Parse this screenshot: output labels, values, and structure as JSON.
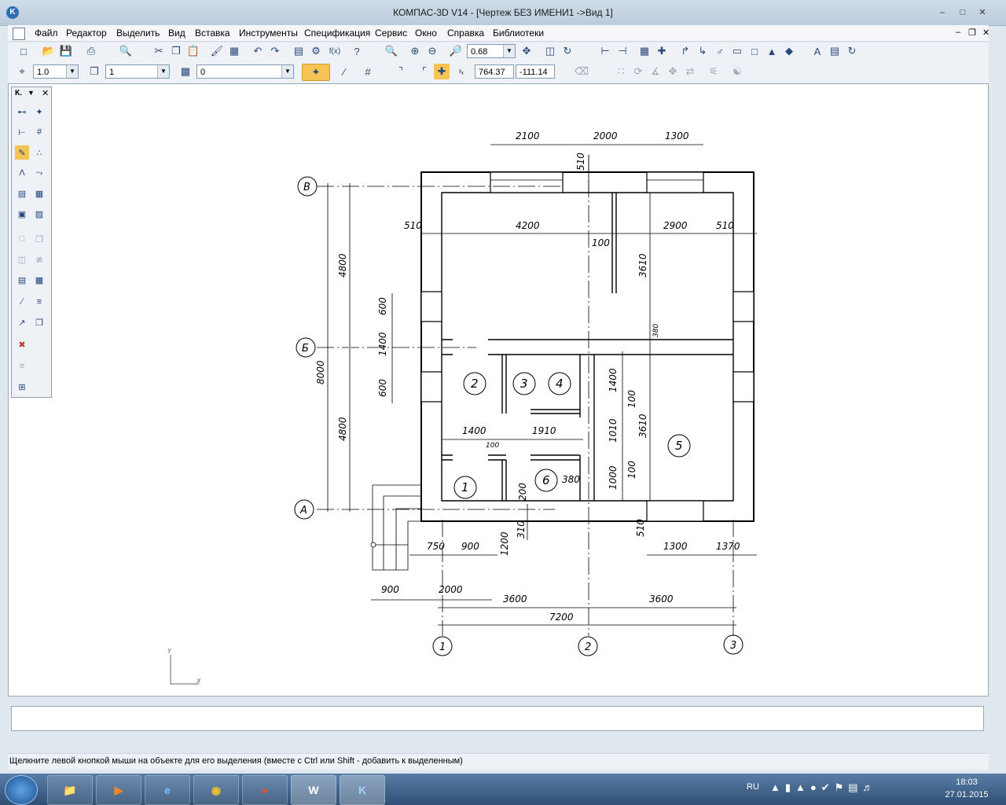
{
  "window": {
    "title": "КОМПАС-3D V14 - [Чертеж БЕЗ ИМЕНИ1 ->Вид 1]",
    "logo": "K"
  },
  "menu": [
    "Файл",
    "Редактор",
    "Выделить",
    "Вид",
    "Вставка",
    "Инструменты",
    "Спецификация",
    "Сервис",
    "Окно",
    "Справка",
    "Библиотеки"
  ],
  "toolbar": {
    "zoom_value": "0.68",
    "line_scale": "1.0",
    "layer": "1",
    "style": "0",
    "coord_x": "764.37",
    "coord_y": "-111.14",
    "fx_label": "f(x)"
  },
  "palette": {
    "title": "К."
  },
  "drawing": {
    "dimensions": {
      "top_2100": "2100",
      "top_2000": "2000",
      "top_1300": "1300",
      "top_510": "510",
      "row_510_left": "510",
      "row_4200": "4200",
      "row_2900": "2900",
      "row_510_right": "510",
      "d_100_top": "100",
      "d_3610_top": "3610",
      "d_380": "380",
      "d_4800_top": "4800",
      "d_8000": "8000",
      "d_4800_bottom": "4800",
      "d_600_a": "600",
      "d_1400_left": "1400",
      "d_600_b": "600",
      "d_1400_h": "1400",
      "d_1910": "1910",
      "d_100_mid": "100",
      "d_1400_v": "1400",
      "d_100_v1": "100",
      "d_1010": "1010",
      "d_3610_bottom": "3610",
      "d_100_v2": "100",
      "d_1000": "1000",
      "d_380_b": "380",
      "d_200": "200",
      "d_1200": "1200",
      "d_310": "310",
      "d_510_bottom": "510",
      "d_750": "750",
      "d_900": "900",
      "d_1300_b": "1300",
      "d_1370": "1370",
      "d_900_b": "900",
      "d_2000_b": "2000",
      "d_3600_left": "3600",
      "d_3600_right": "3600",
      "d_7200": "7200"
    },
    "axes_letters": [
      "В",
      "Б",
      "А"
    ],
    "axes_numbers": [
      "1",
      "2",
      "3"
    ],
    "rooms": [
      "1",
      "2",
      "3",
      "4",
      "5",
      "6"
    ],
    "ucs_x": "X",
    "ucs_y": "Y"
  },
  "status": {
    "hint": "Щелкните левой кнопкой мыши на объекте для его выделения (вместе с Ctrl или Shift - добавить к выделенным)"
  },
  "taskbar": {
    "lang": "RU",
    "time": "18:03",
    "date": "27.01.2015",
    "apps": [
      "explorer",
      "media-player",
      "ie",
      "chrome",
      "presentation",
      "word",
      "kompas"
    ]
  }
}
